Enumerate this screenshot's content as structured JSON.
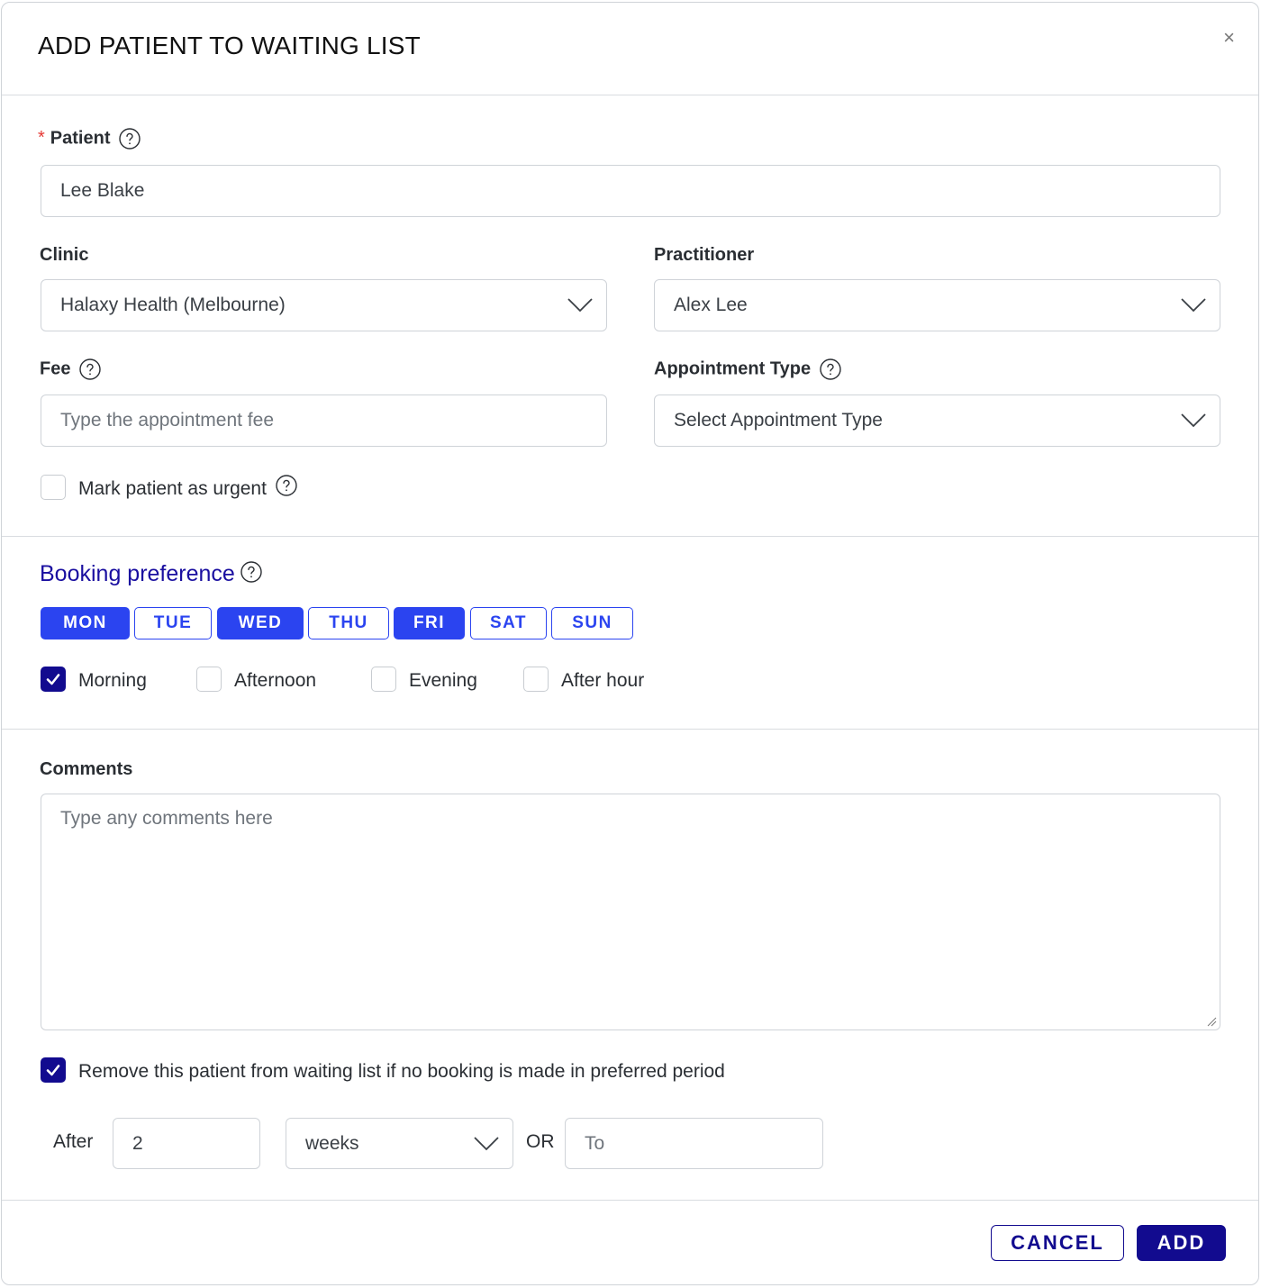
{
  "dialog": {
    "title": "ADD PATIENT TO WAITING LIST",
    "close_symbol": "×"
  },
  "patient": {
    "required_marker": "*",
    "label": "Patient",
    "value": "Lee Blake"
  },
  "clinic": {
    "label": "Clinic",
    "value": "Halaxy Health (Melbourne)"
  },
  "practitioner": {
    "label": "Practitioner",
    "value": "Alex Lee"
  },
  "fee": {
    "label": "Fee",
    "placeholder": "Type the appointment fee"
  },
  "appointment_type": {
    "label": "Appointment Type",
    "placeholder": "Select Appointment Type"
  },
  "urgent": {
    "label": "Mark patient as urgent",
    "checked": false
  },
  "booking_preference": {
    "title": "Booking preference",
    "days": [
      {
        "label": "MON",
        "selected": true
      },
      {
        "label": "TUE",
        "selected": false
      },
      {
        "label": "WED",
        "selected": true
      },
      {
        "label": "THU",
        "selected": false
      },
      {
        "label": "FRI",
        "selected": true
      },
      {
        "label": "SAT",
        "selected": false
      },
      {
        "label": "SUN",
        "selected": false
      }
    ],
    "times": [
      {
        "label": "Morning",
        "checked": true
      },
      {
        "label": "Afternoon",
        "checked": false
      },
      {
        "label": "Evening",
        "checked": false
      },
      {
        "label": "After hour",
        "checked": false
      }
    ]
  },
  "comments": {
    "label": "Comments",
    "placeholder": "Type any comments here"
  },
  "removal": {
    "label": "Remove this patient from waiting list if no booking is made in preferred period",
    "checked": true,
    "after_label": "After",
    "after_value": "2",
    "unit_value": "weeks",
    "or_label": "OR",
    "to_placeholder": "To"
  },
  "footer": {
    "cancel_label": "CANCEL",
    "add_label": "ADD"
  },
  "colors": {
    "primary_dark": "#120b8f",
    "day_blue": "#2b44f0",
    "required_red": "#e53935"
  },
  "icons": {
    "help": "question-circle-icon",
    "dropdown": "chevron-down-icon",
    "check": "check-icon",
    "close": "close-icon"
  }
}
